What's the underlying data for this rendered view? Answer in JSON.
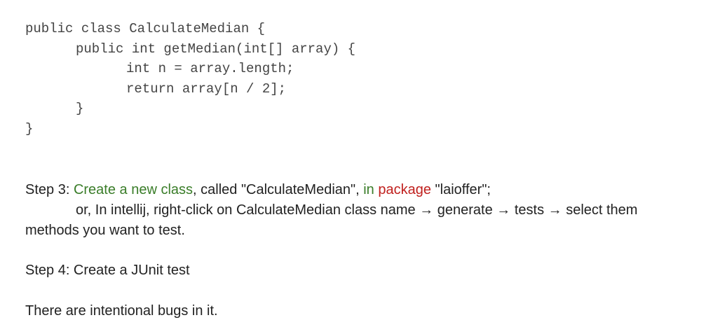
{
  "code": {
    "lines": [
      "public class CalculateMedian {",
      "public int getMedian(int[] array) {",
      "int n = array.length;",
      "return array[n / 2];",
      "}",
      "}"
    ]
  },
  "step3": {
    "prefix": "Step 3: ",
    "create_text": "Create a new class",
    "called_text": ", called \"CalculateMedian\", ",
    "in_text": "in",
    "space": " ",
    "package_text": "package",
    "package_name": " \"laioffer\";",
    "continuation": "or, In intellij, right-click on CalculateMedian class name → generate → tests → select them methods you want to test."
  },
  "step4": {
    "text": "Step 4: Create a JUnit test"
  },
  "note": {
    "text": "There are intentional bugs in it."
  },
  "colors": {
    "green": "#3a7d29",
    "red": "#c0201e",
    "code_text": "#444444",
    "body_text": "#222222"
  }
}
